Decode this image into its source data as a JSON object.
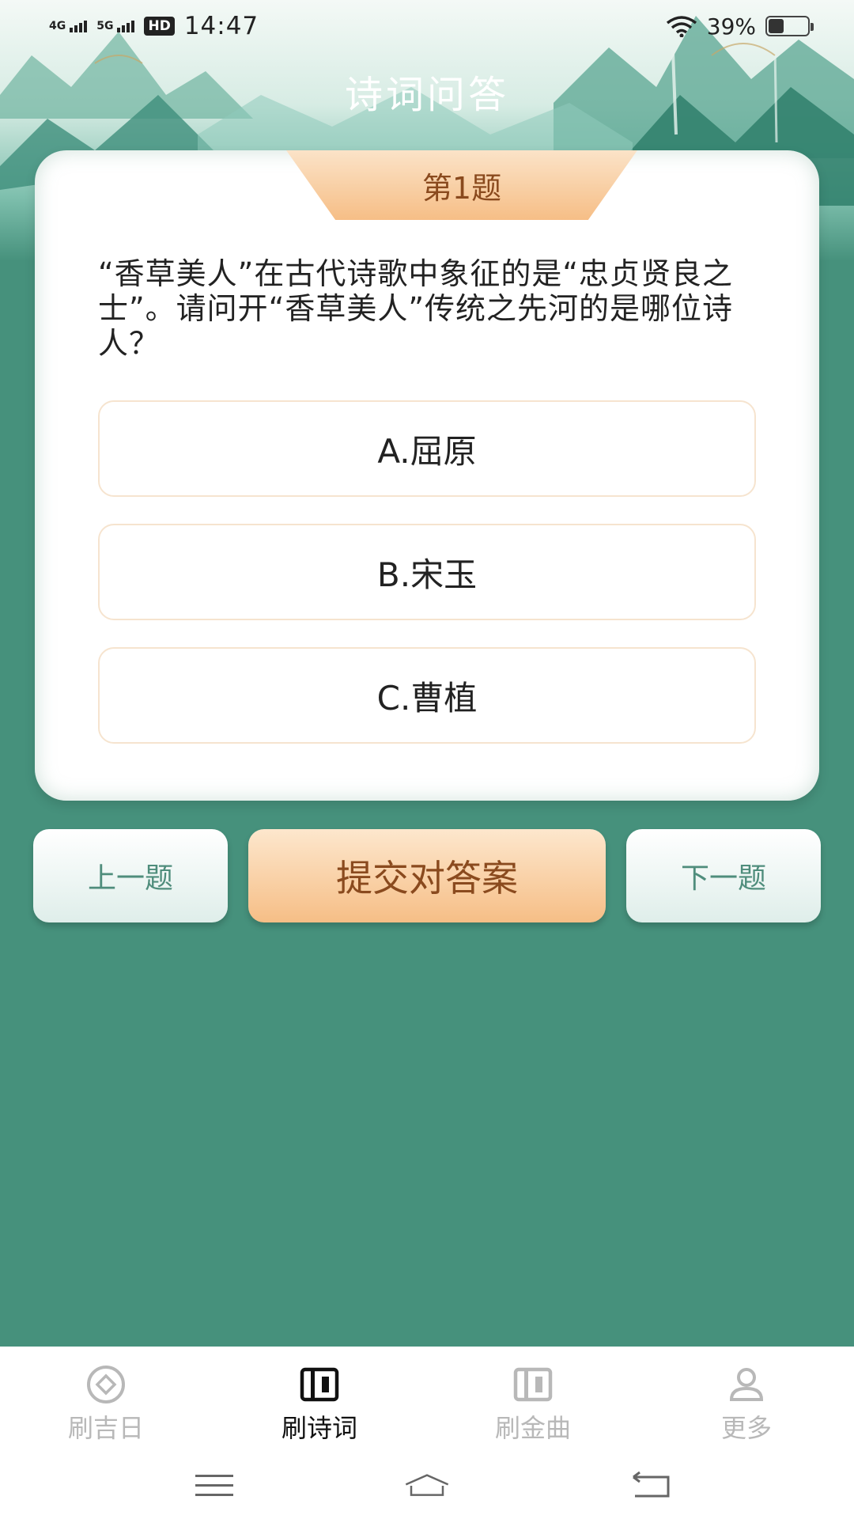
{
  "status_bar": {
    "network_1": "4G",
    "network_2": "5G",
    "hd_badge": "HD",
    "time": "14:47",
    "battery_text": "39%",
    "battery_level": 0.39
  },
  "header": {
    "title": "诗词问答"
  },
  "quiz": {
    "question_number": "第1题",
    "question_text": "“香草美人”在古代诗歌中象征的是“忠贞贤良之士”。请问开“香草美人”传统之先河的是哪位诗人？",
    "options": [
      {
        "label": "A.屈原"
      },
      {
        "label": "B.宋玉"
      },
      {
        "label": "C.曹植"
      }
    ]
  },
  "actions": {
    "prev_label": "上一题",
    "submit_label": "提交对答案",
    "next_label": "下一题"
  },
  "tabbar": {
    "items": [
      {
        "label": "刷吉日",
        "icon": "coin-icon",
        "active": false
      },
      {
        "label": "刷诗词",
        "icon": "book-icon",
        "active": true
      },
      {
        "label": "刷金曲",
        "icon": "album-icon",
        "active": false
      },
      {
        "label": "更多",
        "icon": "person-icon",
        "active": false
      }
    ]
  },
  "system_nav": [
    "menu-icon",
    "home-icon",
    "back-icon"
  ],
  "colors": {
    "background": "#46917c",
    "accent_orange": "#f6be86",
    "accent_text": "#8a4a1e",
    "secondary_text": "#4f8d7c"
  }
}
